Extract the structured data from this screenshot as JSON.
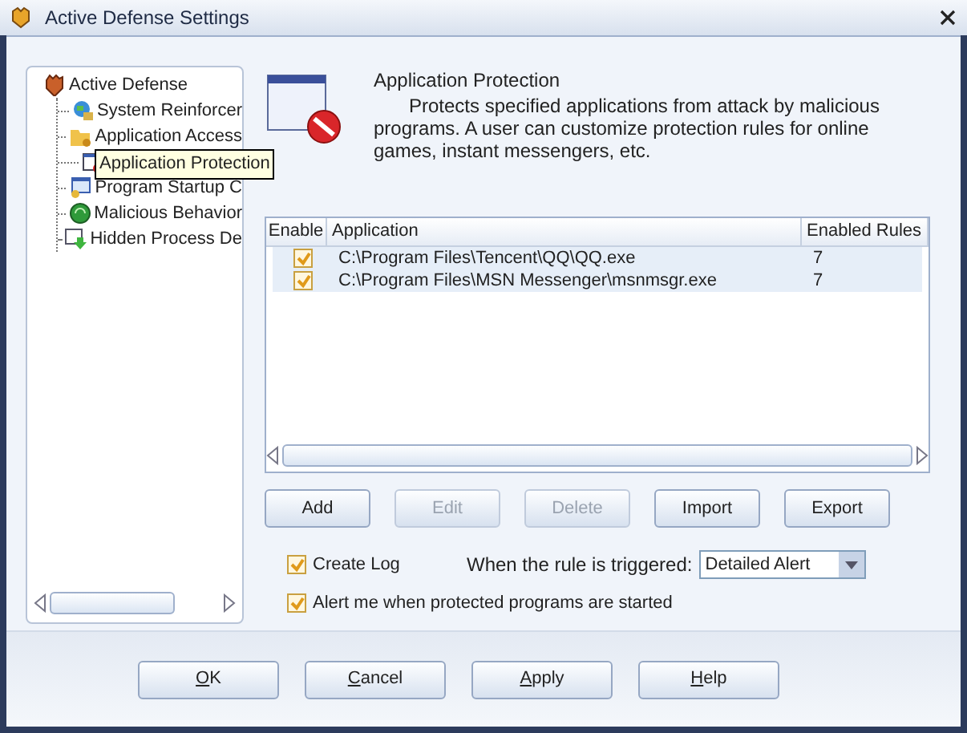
{
  "window": {
    "title": "Active Defense Settings"
  },
  "tree": {
    "label": "Active Defense",
    "children": [
      {
        "label": "System Reinforcer",
        "selected": false
      },
      {
        "label": "Application Access",
        "selected": false
      },
      {
        "label": "Application Protection",
        "selected": true
      },
      {
        "label": "Program Startup C",
        "selected": false
      },
      {
        "label": "Malicious Behavior",
        "selected": false
      },
      {
        "label": "Hidden Process De",
        "selected": false
      }
    ]
  },
  "header": {
    "title": "Application Protection",
    "description": "Protects specified applications from attack by malicious programs. A user can customize protection rules for online games, instant messengers, etc."
  },
  "table": {
    "columns": [
      "Enable",
      "Application",
      "Enabled Rules"
    ],
    "rows": [
      {
        "enabled": true,
        "application": "C:\\Program Files\\Tencent\\QQ\\QQ.exe",
        "rules": "7"
      },
      {
        "enabled": true,
        "application": "C:\\Program Files\\MSN Messenger\\msnmsgr.exe",
        "rules": "7"
      }
    ]
  },
  "actions": [
    {
      "label": "Add",
      "disabled": false
    },
    {
      "label": "Edit",
      "disabled": true
    },
    {
      "label": "Delete",
      "disabled": true
    },
    {
      "label": "Import",
      "disabled": false
    },
    {
      "label": "Export",
      "disabled": false
    }
  ],
  "options": {
    "create_log": {
      "label": "Create Log",
      "checked": true
    },
    "trigger_label": "When the rule is triggered:",
    "trigger_value": "Detailed Alert",
    "alert_on_start": {
      "label": "Alert me when protected programs are started",
      "checked": true
    }
  },
  "footer_buttons": [
    {
      "label": "OK",
      "underline_first": true
    },
    {
      "label": "Cancel",
      "underline_first": true
    },
    {
      "label": "Apply",
      "underline_first": true
    },
    {
      "label": "Help",
      "underline_first": true
    }
  ]
}
